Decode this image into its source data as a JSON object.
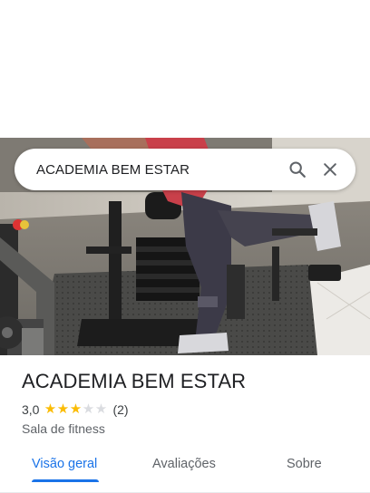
{
  "search": {
    "query": "ACADEMIA BEM ESTAR",
    "search_icon": "search-icon",
    "close_icon": "close-icon"
  },
  "hero": {
    "image": "gym-photo"
  },
  "place": {
    "name": "ACADEMIA BEM ESTAR",
    "rating_text": "3,0",
    "rating_value": 3.0,
    "rating_max": 5,
    "review_count": "(2)",
    "category": "Sala de fitness"
  },
  "tabs": [
    {
      "label": "Visão geral",
      "active": true
    },
    {
      "label": "Avaliações",
      "active": false
    },
    {
      "label": "Sobre",
      "active": false
    }
  ],
  "colors": {
    "accent": "#1a73e8",
    "star": "#fbbc04",
    "star_empty": "#dadce0"
  }
}
